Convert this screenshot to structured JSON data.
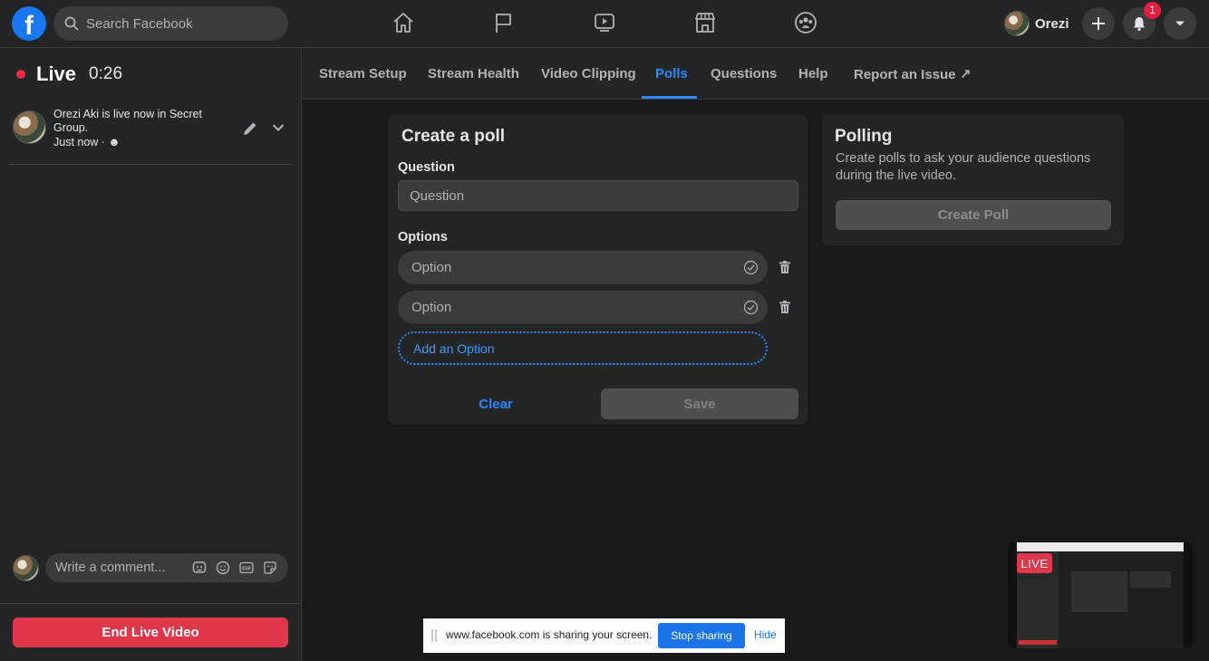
{
  "topbar": {
    "logo": "f",
    "search_placeholder": "Search Facebook",
    "nav_icons": [
      "home-icon",
      "flag-icon",
      "watch-icon",
      "marketplace-icon",
      "groups-icon"
    ],
    "profile_name": "Orezi",
    "notification_count": "1"
  },
  "left": {
    "live_label": "Live",
    "live_time": "0:26",
    "post_text": "Orezi Aki is live now in Secret Group.",
    "post_time": "Just now · ☻",
    "comment_placeholder": "Write a comment...",
    "end_button": "End Live Video"
  },
  "tabs": [
    {
      "label": "Stream Setup"
    },
    {
      "label": "Stream Health"
    },
    {
      "label": "Video Clipping"
    },
    {
      "label": "Polls"
    },
    {
      "label": "Questions"
    },
    {
      "label": "Help"
    },
    {
      "label": "Report an Issue ↗"
    }
  ],
  "active_tab": "Polls",
  "poll_form": {
    "title": "Create a poll",
    "question_label": "Question",
    "question_placeholder": "Question",
    "options_label": "Options",
    "option_placeholder_1": "Option",
    "option_placeholder_2": "Option",
    "add_option": "Add an Option",
    "clear": "Clear",
    "save": "Save"
  },
  "polling": {
    "title": "Polling",
    "description": "Create polls to ask your audience questions during the live video.",
    "button": "Create Poll"
  },
  "sharebar": {
    "text": "www.facebook.com is sharing your screen.",
    "stop": "Stop sharing",
    "hide": "Hide"
  },
  "preview": {
    "live_tag": "LIVE"
  },
  "colors": {
    "accent": "#2d88ff",
    "live_red": "#e0374a",
    "background": "#18191a",
    "surface": "#242526"
  }
}
